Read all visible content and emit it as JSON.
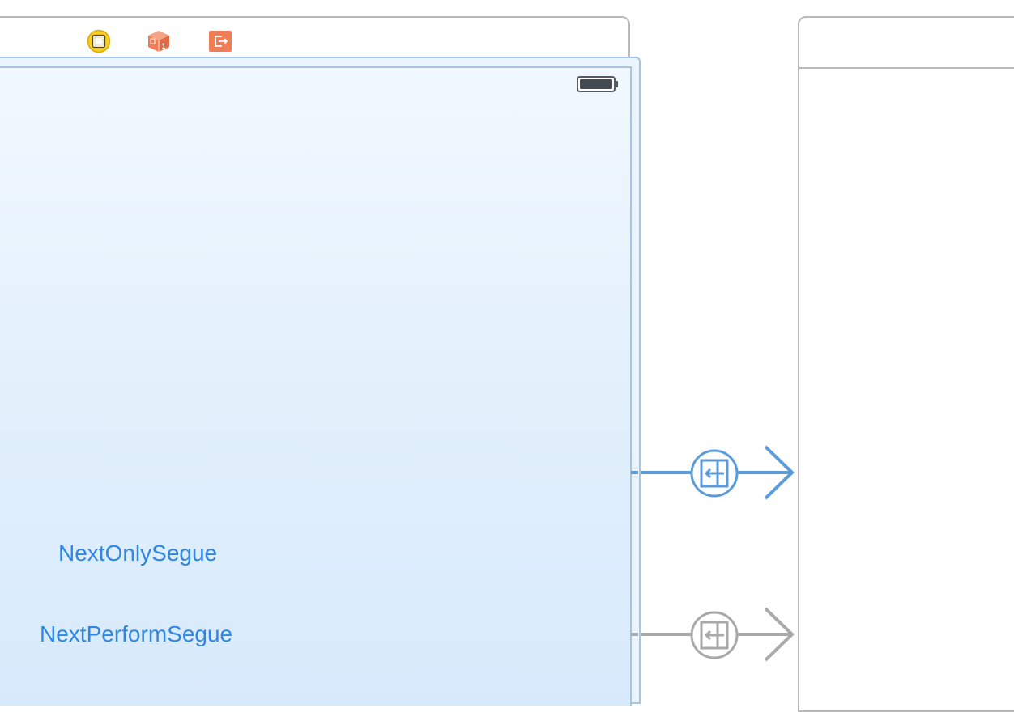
{
  "canvas": {
    "buttons": {
      "next_only": "NextOnlySegue",
      "next_perform": "NextPerformSegue"
    }
  },
  "scene_dock": {
    "icons": [
      "view-controller-icon",
      "first-responder-icon",
      "exit-icon"
    ]
  },
  "segues": [
    {
      "name": "show-segue-selected",
      "state": "selected",
      "color": "#5b9bd9"
    },
    {
      "name": "show-segue",
      "state": "normal",
      "color": "#a9a9ab"
    }
  ],
  "colors": {
    "accent": "#2f86e3",
    "view_controller_icon": "#f5c518",
    "first_responder_icon": "#f07d55",
    "exit_icon": "#f07d55",
    "canvas_bg": "#e3f0fc",
    "frame_border": "#b9b9bd"
  }
}
